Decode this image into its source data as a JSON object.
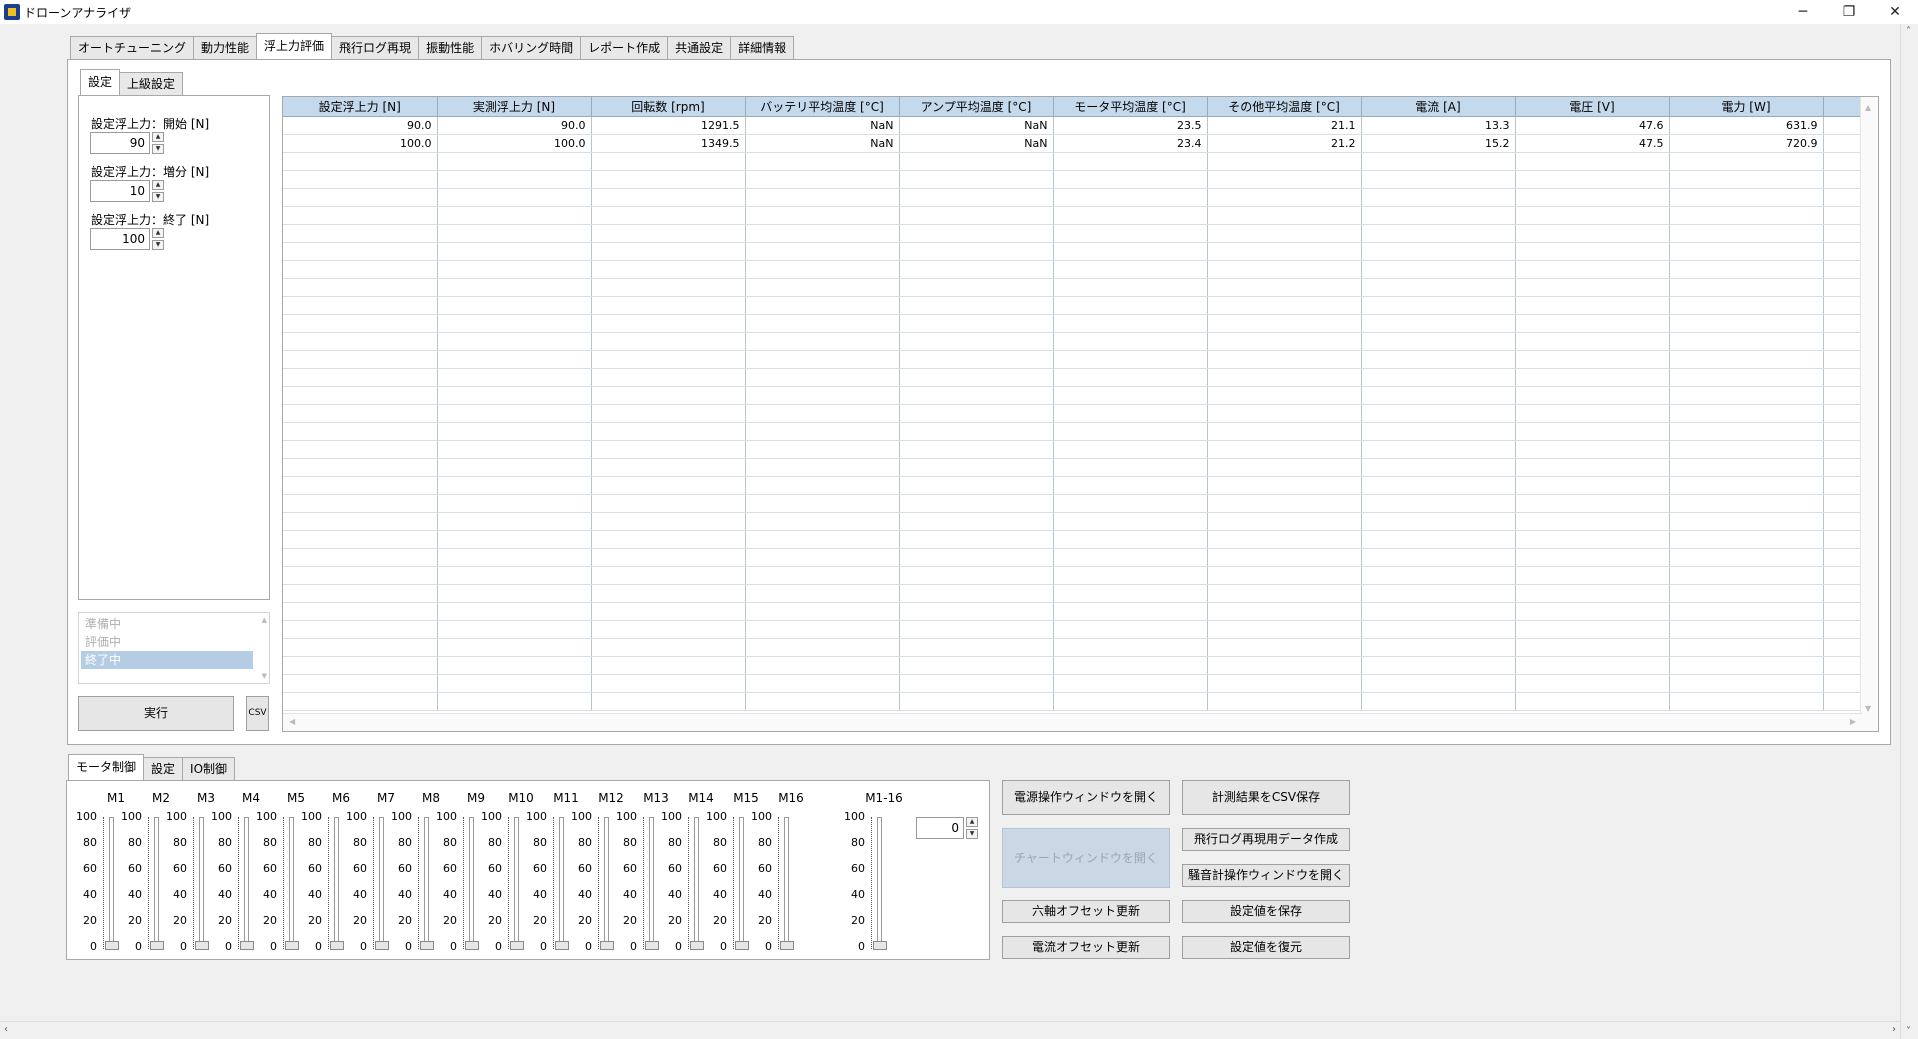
{
  "window": {
    "title": "ドローンアナライザ",
    "minimize": "─",
    "maximize": "❐",
    "close": "✕"
  },
  "tabs": [
    "オートチューニング",
    "動力性能",
    "浮上力評価",
    "飛行ログ再現",
    "振動性能",
    "ホバリング時間",
    "レポート作成",
    "共通設定",
    "詳細情報"
  ],
  "active_tab": 2,
  "settings_tabs": [
    "設定",
    "上級設定"
  ],
  "settings": {
    "fields": [
      {
        "label": "設定浮上力：開始 [N]",
        "value": "90"
      },
      {
        "label": "設定浮上力：増分 [N]",
        "value": "10"
      },
      {
        "label": "設定浮上力：終了 [N]",
        "value": "100"
      }
    ]
  },
  "status_list": [
    "準備中",
    "評価中",
    "終了中"
  ],
  "status_selected": 2,
  "run_button": "実行",
  "csv_button": "CSV",
  "table": {
    "headers": [
      "設定浮上力 [N]",
      "実測浮上力 [N]",
      "回転数 [rpm]",
      "バッテリ平均温度 [°C]",
      "アンプ平均温度 [°C]",
      "モータ平均温度 [°C]",
      "その他平均温度 [°C]",
      "電流 [A]",
      "電圧 [V]",
      "電力 [W]"
    ],
    "rows": [
      [
        "90.0",
        "90.0",
        "1291.5",
        "NaN",
        "NaN",
        "23.5",
        "21.1",
        "13.3",
        "47.6",
        "631.9"
      ],
      [
        "100.0",
        "100.0",
        "1349.5",
        "NaN",
        "NaN",
        "23.4",
        "21.2",
        "15.2",
        "47.5",
        "720.9"
      ]
    ]
  },
  "bottom_tabs": [
    "モータ制御",
    "設定",
    "IO制御"
  ],
  "motors": [
    "M1",
    "M2",
    "M3",
    "M4",
    "M5",
    "M6",
    "M7",
    "M8",
    "M9",
    "M10",
    "M11",
    "M12",
    "M13",
    "M14",
    "M15",
    "M16"
  ],
  "motor_values": [
    0,
    0,
    0,
    0,
    0,
    0,
    0,
    0,
    0,
    0,
    0,
    0,
    0,
    0,
    0,
    0
  ],
  "all_motors": {
    "label": "M1-16",
    "value": "0"
  },
  "scale_labels": [
    "100",
    "80",
    "60",
    "40",
    "20",
    "0"
  ],
  "actions": {
    "power_window": "電源操作ウィンドウを開く",
    "save_csv": "計測結果をCSV保存",
    "chart_window": "チャートウィンドウを開く",
    "log_data": "飛行ログ再現用データ作成",
    "noise_window": "騒音計操作ウィンドウを開く",
    "six_axis_offset": "六軸オフセット更新",
    "save_settings": "設定値を保存",
    "current_offset": "電流オフセット更新",
    "restore_settings": "設定値を復元"
  }
}
